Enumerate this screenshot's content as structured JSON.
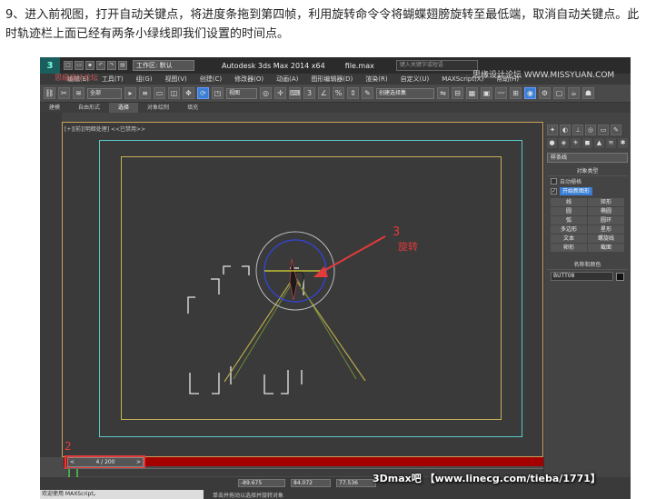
{
  "instruction": "9、进入前视图，打开自动关键点，将进度条拖到第四帧，利用旋转命令令将蝴蝶翅膀旋转至最低端，取消自动关键点。此时轨迹栏上面已经有两条小绿线即我们设置的时间点。",
  "app": {
    "logo_text": "3",
    "workspace": "工作区: 默认",
    "title": "Autodesk 3ds Max  2014 x64",
    "file": "file.max",
    "search_placeholder": "键入关键字或短语"
  },
  "menu": [
    "编辑(E)",
    "工具(T)",
    "组(G)",
    "视图(V)",
    "创建(C)",
    "修改器(O)",
    "动画(A)",
    "图形编辑器(D)",
    "渲染(R)",
    "自定义(U)",
    "MAXScript(X)",
    "帮助(H)"
  ],
  "toolbar": {
    "filter": "全部",
    "refcoord": "视图",
    "named_sel": "创建选择集"
  },
  "ribbon": [
    "建模",
    "自由形式",
    "选择",
    "对象绘制",
    "填充"
  ],
  "ribbon_active": 2,
  "viewport": {
    "label": "[+][前][明暗处理] <<已禁用>>"
  },
  "annotations": {
    "a3_num": "3",
    "a3_text": "旋转",
    "a2_num": "2"
  },
  "command_panel": {
    "category": "样条线",
    "rollout_object_type": "对象类型",
    "autogrid": "自动栅格",
    "start_new_shape": "开始新图形",
    "buttons": [
      "线",
      "矩形",
      "圆",
      "椭圆",
      "弧",
      "圆环",
      "多边形",
      "星形",
      "文本",
      "螺旋线",
      "卵形",
      "截面"
    ],
    "rollout_name_color": "名称和颜色",
    "object_name": "BUTT08"
  },
  "timeline": {
    "frame": "4 / 200"
  },
  "status": {
    "x": "-89.675",
    "y": "84.072",
    "z": "77.536",
    "maxscript": "欢迎使用 MAXScript。",
    "prompt": "单击并拖动以选择并旋转对象"
  },
  "watermark": "3Dmax吧 【www.linecg.com/tieba/1771】",
  "watermark_top": "思缘设计论坛 WWW.MISSYUAN.COM",
  "watermark_left": "思缘设计论坛"
}
